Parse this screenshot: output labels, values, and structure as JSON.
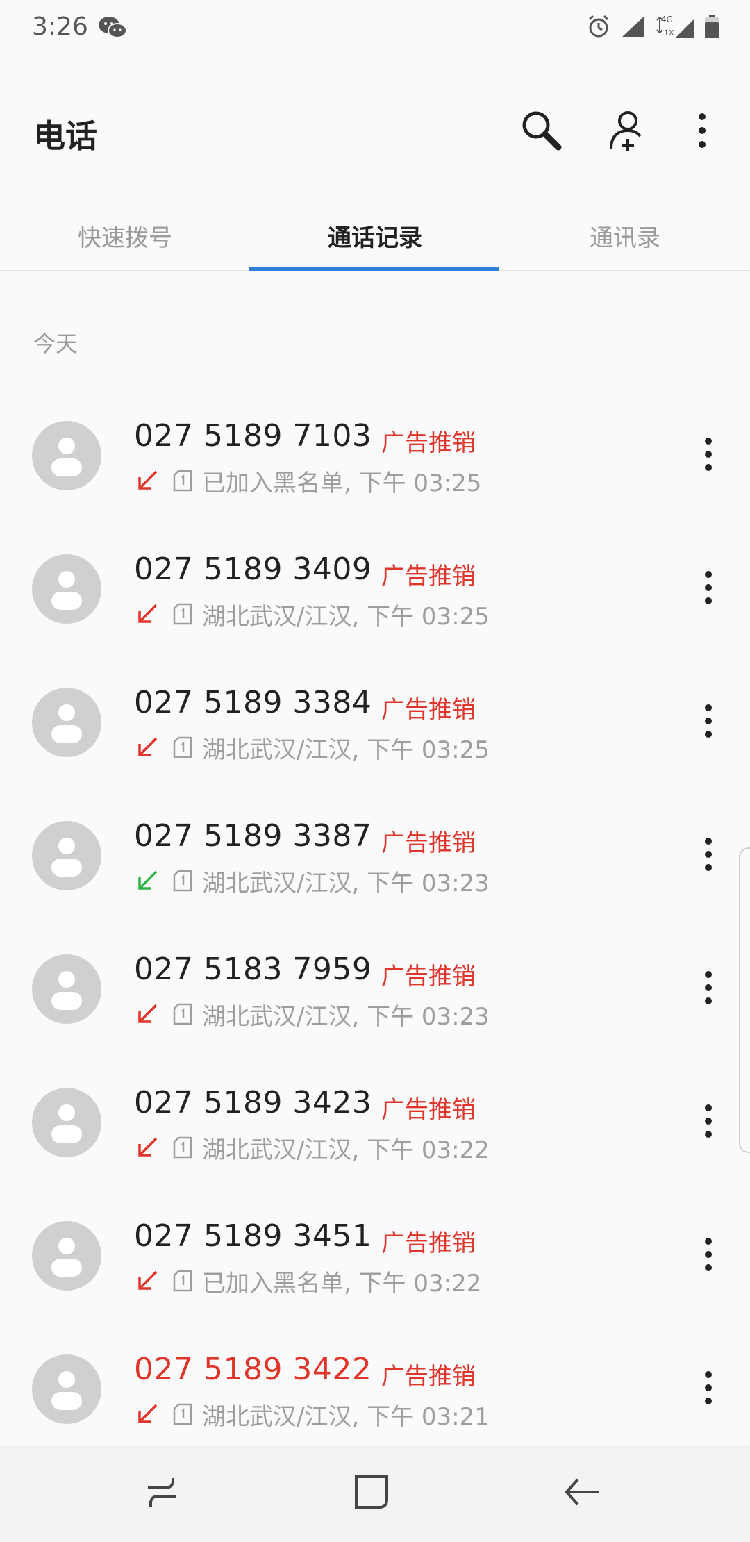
{
  "status_bar": {
    "time": "3:26",
    "network_label": "4G",
    "network_sub": "1X"
  },
  "app_bar": {
    "title": "电话",
    "icons": [
      "search-icon",
      "add-contact-icon",
      "more-vert-icon"
    ]
  },
  "tabs": [
    {
      "label": "快速拨号",
      "active": false
    },
    {
      "label": "通话记录",
      "active": true
    },
    {
      "label": "通讯录",
      "active": false
    }
  ],
  "section_label": "今天",
  "colors": {
    "accent": "#2f80d6",
    "missed": "#e0352b",
    "incoming": "#2eb34a",
    "secondary_text": "#9e9e9e"
  },
  "calls": [
    {
      "number": "027 5189 7103",
      "tag": "广告推销",
      "detail": "已加入黑名单, 下午 03:25",
      "type": "missed",
      "number_missed": false
    },
    {
      "number": "027 5189 3409",
      "tag": "广告推销",
      "detail": "湖北武汉/江汉, 下午 03:25",
      "type": "missed",
      "number_missed": false
    },
    {
      "number": "027 5189 3384",
      "tag": "广告推销",
      "detail": "湖北武汉/江汉, 下午 03:25",
      "type": "missed",
      "number_missed": false
    },
    {
      "number": "027 5189 3387",
      "tag": "广告推销",
      "detail": "湖北武汉/江汉, 下午 03:23",
      "type": "incoming",
      "number_missed": false
    },
    {
      "number": "027 5183 7959",
      "tag": "广告推销",
      "detail": "湖北武汉/江汉, 下午 03:23",
      "type": "missed",
      "number_missed": false
    },
    {
      "number": "027 5189 3423",
      "tag": "广告推销",
      "detail": "湖北武汉/江汉, 下午 03:22",
      "type": "missed",
      "number_missed": false
    },
    {
      "number": "027 5189 3451",
      "tag": "广告推销",
      "detail": "已加入黑名单, 下午 03:22",
      "type": "missed",
      "number_missed": false
    },
    {
      "number": "027 5189 3422",
      "tag": "广告推销",
      "detail": "湖北武汉/江汉, 下午 03:21",
      "type": "missed",
      "number_missed": true
    }
  ],
  "nav_bar": {
    "icons": [
      "recents-icon",
      "home-icon",
      "back-icon"
    ]
  }
}
